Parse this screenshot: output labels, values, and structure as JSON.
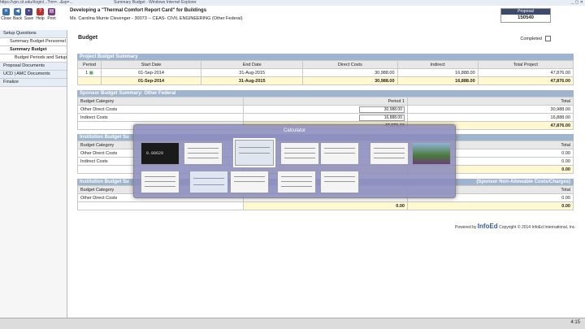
{
  "window": {
    "title_left": "https://vpn.cit.edu/rlogin/...?rm=...&sp=...",
    "title_mid": "Summary Budget - Windows Internet Explorer",
    "controls": "_ ▢ ✕"
  },
  "toolbar": {
    "close": "Close",
    "back": "Back",
    "save": "Save",
    "help": "Help",
    "print": "Print"
  },
  "header": {
    "title": "Developing a \"Thermal Comfort Report Card\" for Buildings",
    "subtitle": "Ms. Carolina Murrie Clevenger - 30073 -- CEAS- CIVIL ENGINEERING (Other Federal)",
    "proposal_label": "Proposal",
    "proposal_number": "150540"
  },
  "sidebar": {
    "items": [
      {
        "label": "Setup Questions"
      },
      {
        "label": "Summary Budget Personnel"
      },
      {
        "label": "Summary Budget"
      },
      {
        "label": "Budget Periods and Setups"
      },
      {
        "label": "Proposal Documents"
      },
      {
        "label": "UCD | AMC Documents"
      },
      {
        "label": "Finalize"
      }
    ]
  },
  "main": {
    "page_title": "Budget",
    "completed_label": "Completed",
    "project_summary": {
      "title": "Project Budget Summary",
      "columns": [
        "Period",
        "Start Date",
        "End Date",
        "Direct Costs",
        "Indirect",
        "Total Project"
      ],
      "rows": [
        [
          "1",
          "01-Sep-2014",
          "31-Aug-2015",
          "30,988.00",
          "16,888.00",
          "47,876.00"
        ]
      ],
      "total": [
        "",
        "01-Sep-2014",
        "31-Aug-2015",
        "30,988.00",
        "16,888.00",
        "47,876.00"
      ]
    },
    "sponsor_summary": {
      "title": "Sponsor Budget Summary: Other Federal",
      "columns": [
        "Budget Category",
        "Period 1",
        "Total"
      ],
      "rows": [
        [
          "Other Direct Costs",
          "30,988.00",
          "30,988.00"
        ],
        [
          "Indirect Costs",
          "16,888.00",
          "16,888.00"
        ]
      ],
      "total": [
        "",
        "47,876.00",
        "47,876.00"
      ]
    },
    "institution_summary": {
      "title": "Institution Budget Su",
      "columns": [
        "Budget Category",
        "",
        "Total"
      ],
      "rows": [
        [
          "Other Direct Costs",
          "",
          "0.00"
        ],
        [
          "Indirect Costs",
          "",
          "0.00"
        ]
      ],
      "total": [
        "",
        "",
        "0.00"
      ]
    },
    "institution_summary2": {
      "title": "Institution Budget Su",
      "right_title": "(Sponsor Non-Allowable Costs/Charges)",
      "columns": [
        "Budget Category",
        "",
        "Total"
      ],
      "rows": [
        [
          "Other Direct Costs",
          "",
          "0.00"
        ]
      ],
      "total": [
        "",
        "0.00",
        "0.00"
      ]
    }
  },
  "footer": {
    "powered": "Powered by",
    "brand": "InfoEd",
    "copyright": "Copyright © 2014 InfoEd International, Inc."
  },
  "switcher": {
    "title": "Calculator",
    "calc_display": "0.00629"
  },
  "taskbar": {
    "time": "4:15"
  }
}
